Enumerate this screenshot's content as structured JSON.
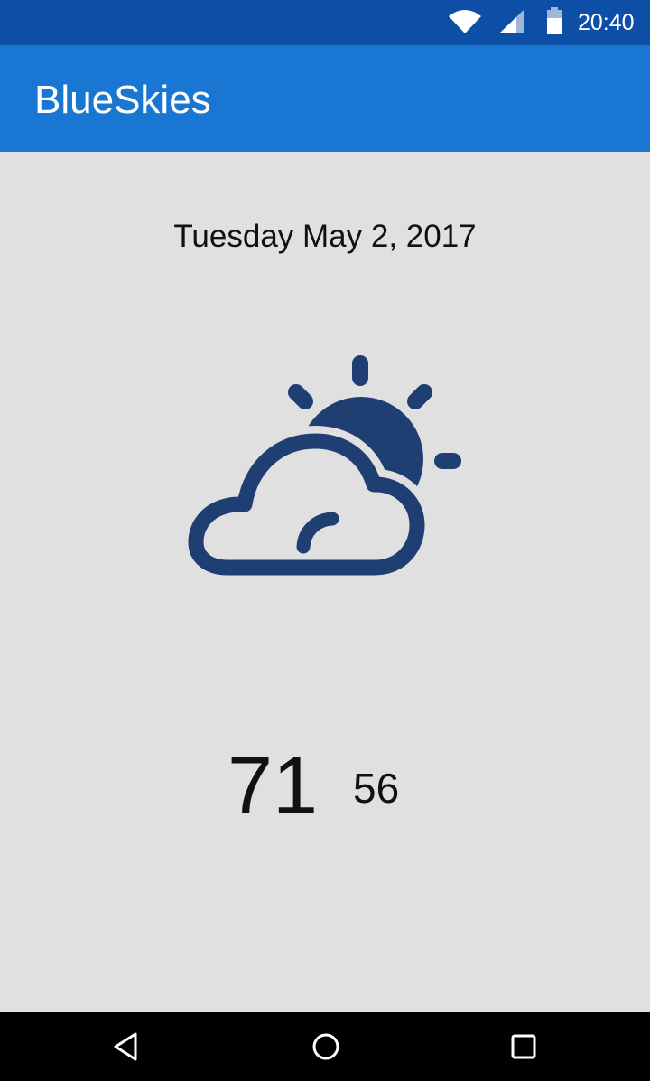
{
  "status_bar": {
    "time": "20:40",
    "icons": [
      "wifi-icon",
      "signal-icon",
      "battery-icon"
    ]
  },
  "app_bar": {
    "title": "BlueSkies"
  },
  "forecast": {
    "date": "Tuesday May 2, 2017",
    "condition_icon": "partly-cloudy-icon",
    "high": "71",
    "low": "56"
  },
  "nav_bar": {
    "buttons": [
      "back-icon",
      "home-icon",
      "recents-icon"
    ]
  },
  "colors": {
    "status_bar": "#0d4fa6",
    "app_bar": "#1976d2",
    "background": "#e0e0e0",
    "icon": "#1f3f73",
    "nav_bar": "#000000"
  }
}
